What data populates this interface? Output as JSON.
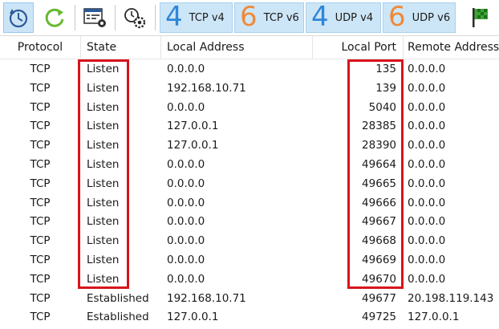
{
  "toolbar": {
    "buttons": [
      {
        "name": "auto-refresh-button",
        "icon": "clock-refresh-icon"
      },
      {
        "name": "refresh-button",
        "icon": "refresh-icon"
      },
      {
        "name": "options-button",
        "icon": "window-settings-icon"
      },
      {
        "name": "resolve-button",
        "icon": "gear-clock-icon"
      }
    ],
    "filters": [
      {
        "digit": "4",
        "label": "TCP v4"
      },
      {
        "digit": "6",
        "label": "TCP v6"
      },
      {
        "digit": "4",
        "label": "UDP v4"
      },
      {
        "digit": "6",
        "label": "UDP v6"
      }
    ],
    "flag_icon": "green-flag-icon"
  },
  "columns": [
    "Protocol",
    "State",
    "Local Address",
    "Local Port",
    "Remote Address"
  ],
  "rows": [
    {
      "protocol": "TCP",
      "state": "Listen",
      "local_address": "0.0.0.0",
      "local_port": "135",
      "remote_address": "0.0.0.0"
    },
    {
      "protocol": "TCP",
      "state": "Listen",
      "local_address": "192.168.10.71",
      "local_port": "139",
      "remote_address": "0.0.0.0"
    },
    {
      "protocol": "TCP",
      "state": "Listen",
      "local_address": "0.0.0.0",
      "local_port": "5040",
      "remote_address": "0.0.0.0"
    },
    {
      "protocol": "TCP",
      "state": "Listen",
      "local_address": "127.0.0.1",
      "local_port": "28385",
      "remote_address": "0.0.0.0"
    },
    {
      "protocol": "TCP",
      "state": "Listen",
      "local_address": "127.0.0.1",
      "local_port": "28390",
      "remote_address": "0.0.0.0"
    },
    {
      "protocol": "TCP",
      "state": "Listen",
      "local_address": "0.0.0.0",
      "local_port": "49664",
      "remote_address": "0.0.0.0"
    },
    {
      "protocol": "TCP",
      "state": "Listen",
      "local_address": "0.0.0.0",
      "local_port": "49665",
      "remote_address": "0.0.0.0"
    },
    {
      "protocol": "TCP",
      "state": "Listen",
      "local_address": "0.0.0.0",
      "local_port": "49666",
      "remote_address": "0.0.0.0"
    },
    {
      "protocol": "TCP",
      "state": "Listen",
      "local_address": "0.0.0.0",
      "local_port": "49667",
      "remote_address": "0.0.0.0"
    },
    {
      "protocol": "TCP",
      "state": "Listen",
      "local_address": "0.0.0.0",
      "local_port": "49668",
      "remote_address": "0.0.0.0"
    },
    {
      "protocol": "TCP",
      "state": "Listen",
      "local_address": "0.0.0.0",
      "local_port": "49669",
      "remote_address": "0.0.0.0"
    },
    {
      "protocol": "TCP",
      "state": "Listen",
      "local_address": "0.0.0.0",
      "local_port": "49670",
      "remote_address": "0.0.0.0"
    },
    {
      "protocol": "TCP",
      "state": "Established",
      "local_address": "192.168.10.71",
      "local_port": "49677",
      "remote_address": "20.198.119.143"
    },
    {
      "protocol": "TCP",
      "state": "Established",
      "local_address": "127.0.0.1",
      "local_port": "49725",
      "remote_address": "127.0.0.1"
    }
  ],
  "colors": {
    "highlight": "#d9141c",
    "ipv4_digit": "#2e86d9",
    "ipv6_digit": "#f0893a",
    "filter_bg": "#cde6f7"
  }
}
